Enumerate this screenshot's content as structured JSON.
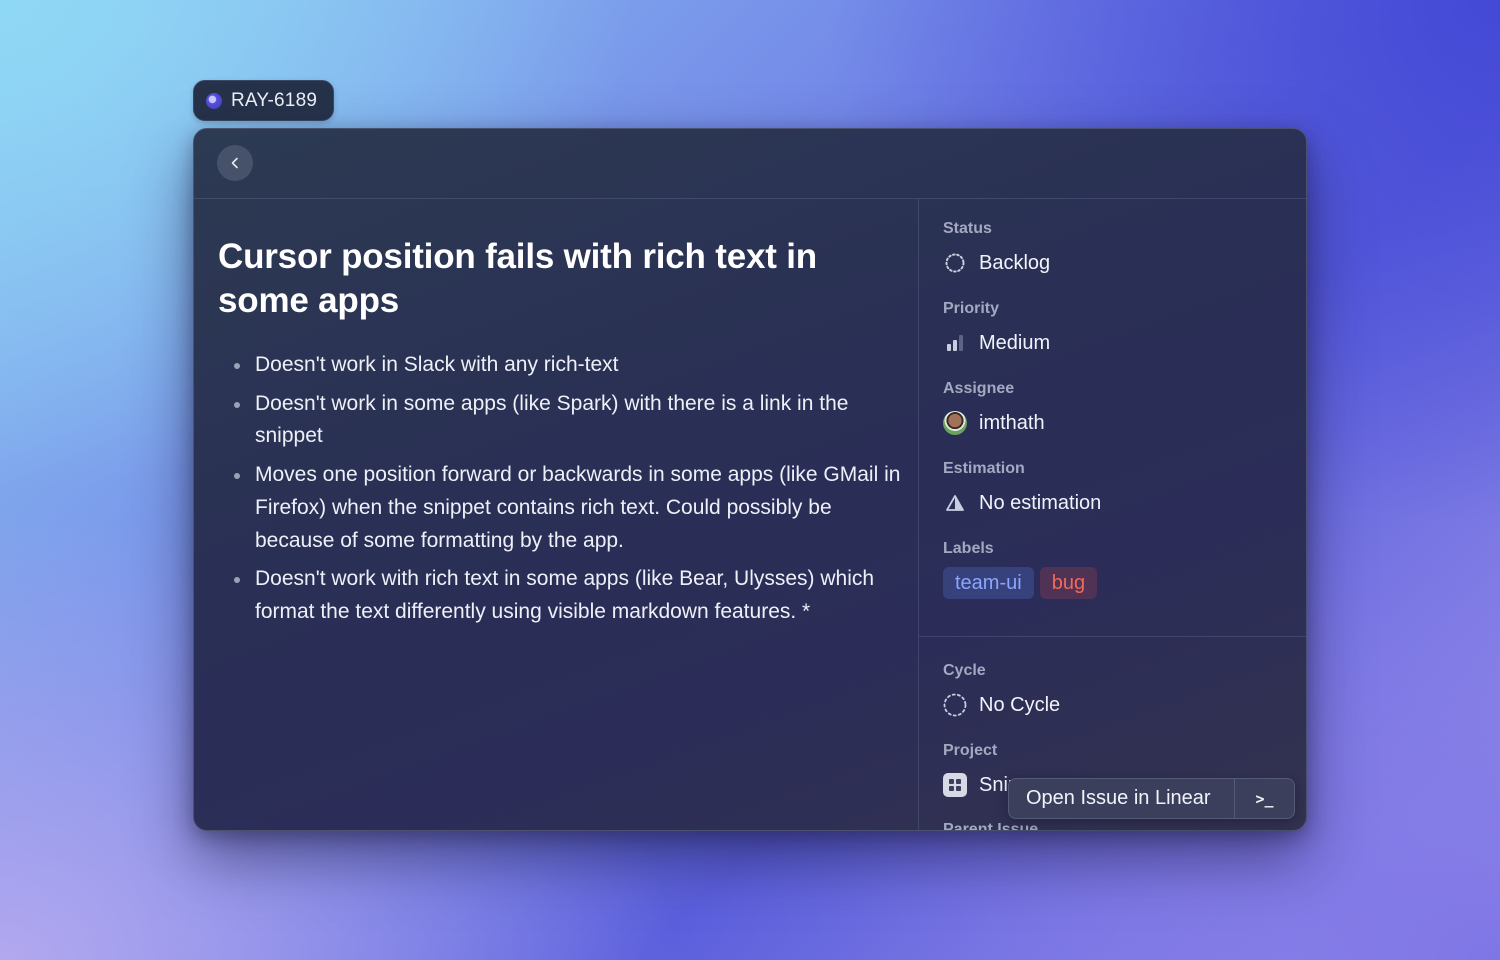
{
  "badge": {
    "issue_id": "RAY-6189",
    "icon": "linear-logo-icon"
  },
  "toolbar": {
    "back_icon": "chevron-left-icon"
  },
  "issue": {
    "title": "Cursor position fails with rich text in some apps",
    "description_bullets": [
      "Doesn't work in Slack with any rich-text",
      "Doesn't work in some apps (like Spark) with there is a link in the snippet",
      "Moves one position forward or backwards in some apps (like GMail in Firefox) when the snippet contains rich text. Could possibly be because of some formatting by the app.",
      "Doesn't work with rich text in some apps (like Bear, Ulysses) which format the text differently using visible markdown features. *"
    ]
  },
  "sidebar": {
    "status": {
      "label": "Status",
      "value": "Backlog",
      "icon": "backlog-dashed-circle-icon"
    },
    "priority": {
      "label": "Priority",
      "value": "Medium",
      "icon": "priority-bars-icon"
    },
    "assignee": {
      "label": "Assignee",
      "value": "imthath",
      "icon": "avatar"
    },
    "estimation": {
      "label": "Estimation",
      "value": "No estimation",
      "icon": "triangle-estimate-icon"
    },
    "labels": {
      "label": "Labels",
      "items": [
        {
          "name": "team-ui",
          "color": "#8aa6ff"
        },
        {
          "name": "bug",
          "color": "#f06a5c"
        }
      ]
    },
    "cycle": {
      "label": "Cycle",
      "value": "No Cycle",
      "icon": "dashed-circle-icon"
    },
    "project": {
      "label": "Project",
      "value": "Snip",
      "icon": "project-grid-icon"
    },
    "parent_issue": {
      "label": "Parent Issue"
    }
  },
  "action_bar": {
    "primary_label": "Open Issue in Linear",
    "shortcut_label": ">_",
    "shortcut_icon": "terminal-icon"
  }
}
